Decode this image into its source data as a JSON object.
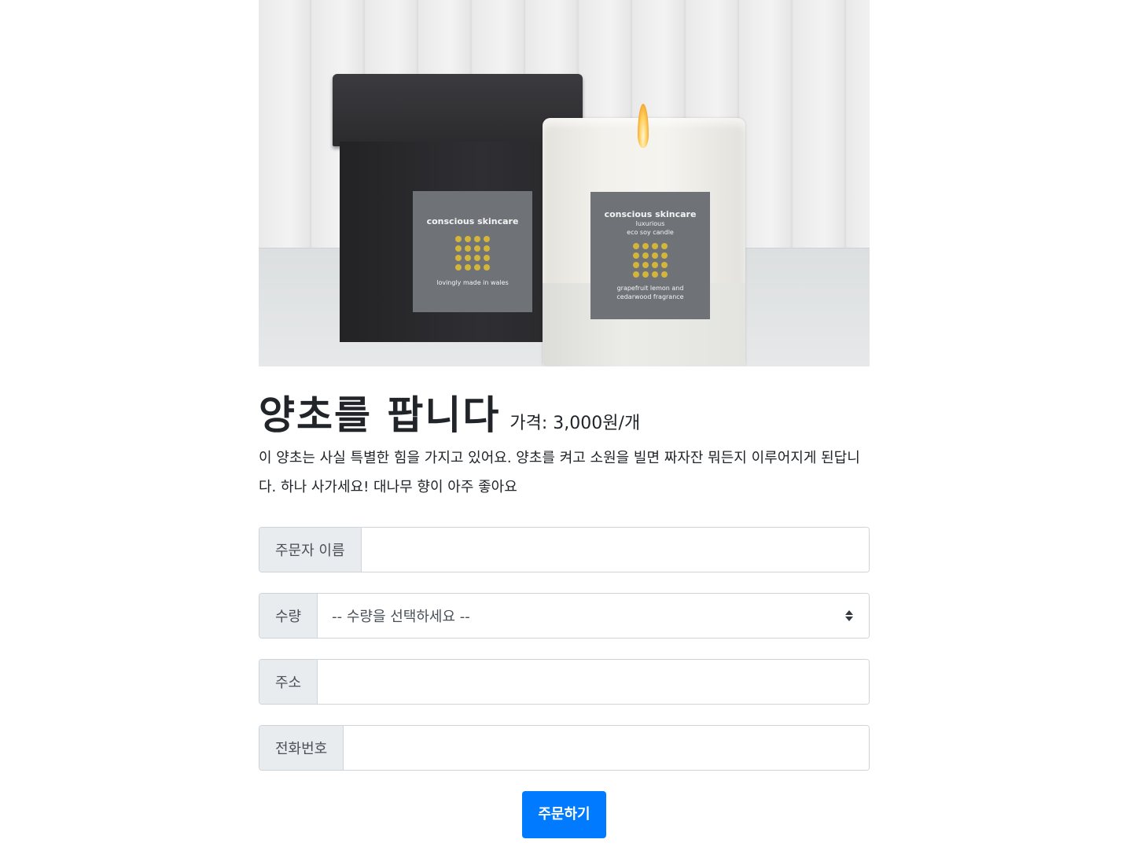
{
  "product": {
    "image_alt": "conscious skincare candle",
    "box_label": {
      "brand": "conscious skincare",
      "tagline": "lovingly made in wales"
    },
    "candle_label": {
      "brand": "conscious skincare",
      "line1": "luxurious",
      "line2": "eco soy candle",
      "line3": "grapefruit lemon and",
      "line4": "cedarwood fragrance"
    },
    "title": "양초를 팝니다",
    "price": "가격: 3,000원/개",
    "description": "이 양초는 사실 특별한 힘을 가지고 있어요. 양초를 켜고 소원을 빌면 짜자잔 뭐든지 이루어지게 된답니다. 하나 사가세요! 대나무 향이 아주 좋아요"
  },
  "form": {
    "name_label": "주문자 이름",
    "name_value": "",
    "quantity_label": "수량",
    "quantity_selected": "-- 수량을 선택하세요 --",
    "address_label": "주소",
    "address_value": "",
    "phone_label": "전화번호",
    "phone_value": "",
    "submit_label": "주문하기"
  },
  "colors": {
    "primary": "#007bff",
    "addon_bg": "#e9ecef",
    "border": "#ced4da"
  }
}
